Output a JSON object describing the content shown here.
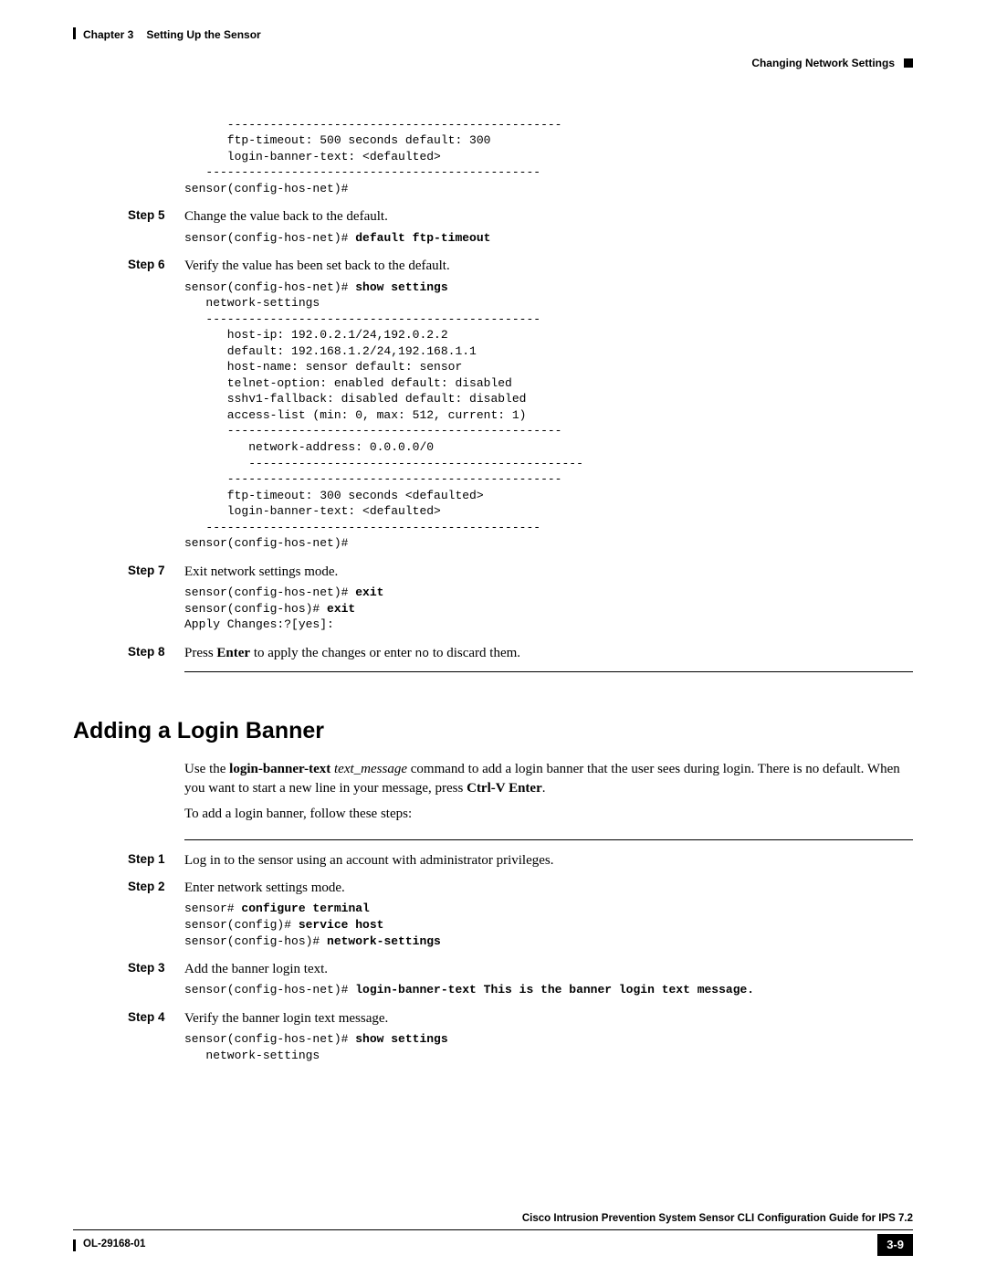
{
  "header": {
    "chapter_label": "Chapter 3",
    "chapter_title": "Setting Up the Sensor",
    "section_right": "Changing Network Settings"
  },
  "pre0": "      -----------------------------------------------\n      ftp-timeout: 500 seconds default: 300\n      login-banner-text: <defaulted>\n   -----------------------------------------------\nsensor(config-hos-net)#",
  "step5": {
    "label": "Step 5",
    "text": "Change the value back to the default.",
    "cmd_prefix": "sensor(config-hos-net)# ",
    "cmd_bold": "default ftp-timeout"
  },
  "step6": {
    "label": "Step 6",
    "text": "Verify the value has been set back to the default.",
    "cmd_prefix": "sensor(config-hos-net)# ",
    "cmd_bold": "show settings",
    "output": "   network-settings\n   -----------------------------------------------\n      host-ip: 192.0.2.1/24,192.0.2.2\n      default: 192.168.1.2/24,192.168.1.1\n      host-name: sensor default: sensor\n      telnet-option: enabled default: disabled\n      sshv1-fallback: disabled default: disabled\n      access-list (min: 0, max: 512, current: 1)\n      -----------------------------------------------\n         network-address: 0.0.0.0/0\n         -----------------------------------------------\n      -----------------------------------------------\n      ftp-timeout: 300 seconds <defaulted>\n      login-banner-text: <defaulted>\n   -----------------------------------------------\nsensor(config-hos-net)#"
  },
  "step7": {
    "label": "Step 7",
    "text": "Exit network settings mode.",
    "cmd1_prefix": "sensor(config-hos-net)# ",
    "cmd1_bold": "exit",
    "cmd2_prefix": "sensor(config-hos)# ",
    "cmd2_bold": "exit",
    "cmd3": "Apply Changes:?[yes]:"
  },
  "step8": {
    "label": "Step 8",
    "text_pre": "Press ",
    "enter": "Enter",
    "text_mid": " to apply the changes or enter ",
    "no_mono": "no",
    "text_post": " to discard them."
  },
  "section2": {
    "title": "Adding a Login Banner",
    "intro_pre": "Use the ",
    "intro_cmd": "login-banner-text",
    "intro_arg": " text_message",
    "intro_post1": " command to add a login banner that the user sees during login. There is no default. When you want to start a new line in your message, press ",
    "ctrlv": "Ctrl-V Enter",
    "intro_post2": ".",
    "intro2": "To add a login banner, follow these steps:"
  },
  "step1b": {
    "label": "Step 1",
    "text": "Log in to the sensor using an account with administrator privileges."
  },
  "step2b": {
    "label": "Step 2",
    "text": "Enter network settings mode.",
    "l1p": "sensor# ",
    "l1b": "configure terminal",
    "l2p": "sensor(config)# ",
    "l2b": "service host",
    "l3p": "sensor(config-hos)# ",
    "l3b": "network-settings"
  },
  "step3b": {
    "label": "Step 3",
    "text": "Add the banner login text.",
    "cmd_prefix": "sensor(config-hos-net)# ",
    "cmd_bold": "login-banner-text This is the banner login text message."
  },
  "step4b": {
    "label": "Step 4",
    "text": "Verify the banner login text message.",
    "cmd_prefix": "sensor(config-hos-net)# ",
    "cmd_bold": "show settings",
    "out": "   network-settings"
  },
  "footer": {
    "guide": "Cisco Intrusion Prevention System Sensor CLI Configuration Guide for IPS 7.2",
    "doc": "OL-29168-01",
    "page": "3-9"
  }
}
